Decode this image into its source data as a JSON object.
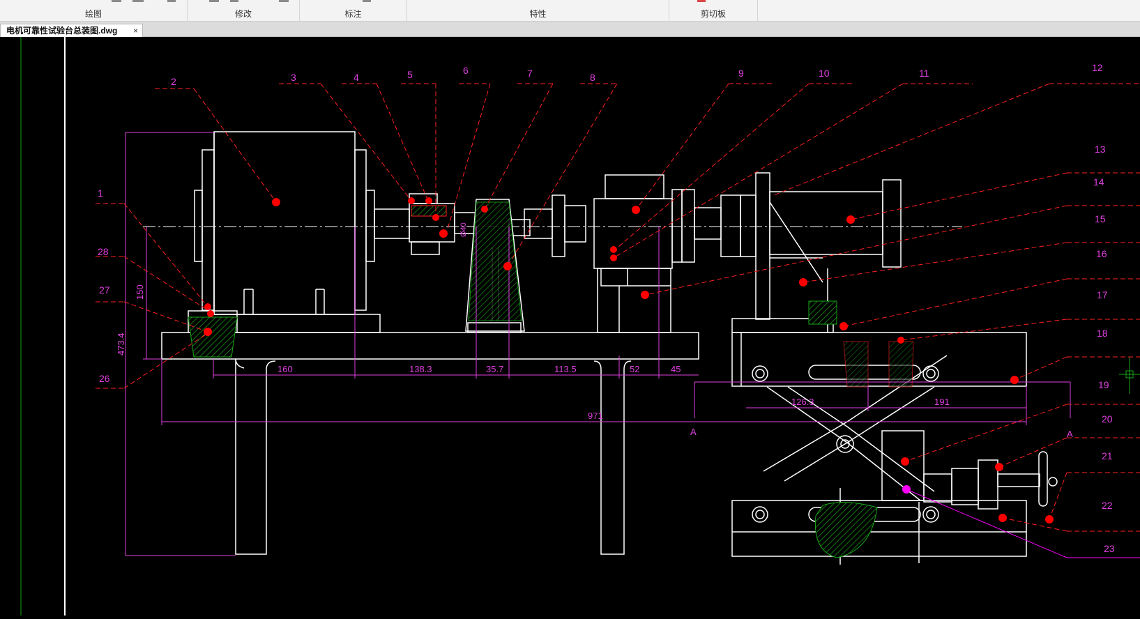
{
  "ribbon": {
    "panels": [
      {
        "label": "绘图"
      },
      {
        "label": "修改"
      },
      {
        "label": "标注"
      },
      {
        "label": "特性"
      },
      {
        "label": "剪切板"
      }
    ]
  },
  "tabs": {
    "active_file": "电机可靠性试验台总装图.dwg",
    "close_glyph": "×"
  },
  "drawing": {
    "part_numbers": [
      "1",
      "2",
      "3",
      "4",
      "5",
      "6",
      "7",
      "8",
      "9",
      "10",
      "11",
      "12",
      "13",
      "14",
      "15",
      "16",
      "17",
      "18",
      "19",
      "20",
      "21",
      "22",
      "23",
      "26",
      "27",
      "28"
    ],
    "dimensions": {
      "d160": "160",
      "d138": "138.3",
      "d35": "35.7",
      "d113": "113.5",
      "d52": "52",
      "d45": "45",
      "d971": "971",
      "d126": "126.3",
      "d191": "191",
      "d150": "150",
      "d473": "473.4",
      "d40": "Ø40"
    },
    "section_labels": {
      "left": "A",
      "right": "A"
    },
    "colors": {
      "background": "#000000",
      "outline": "#ffffff",
      "leader": "#ff2020",
      "dimension": "#e040e0",
      "hatch": "#19a619",
      "marker": "#ff0000",
      "magenta_marker": "#ff00ff"
    }
  }
}
